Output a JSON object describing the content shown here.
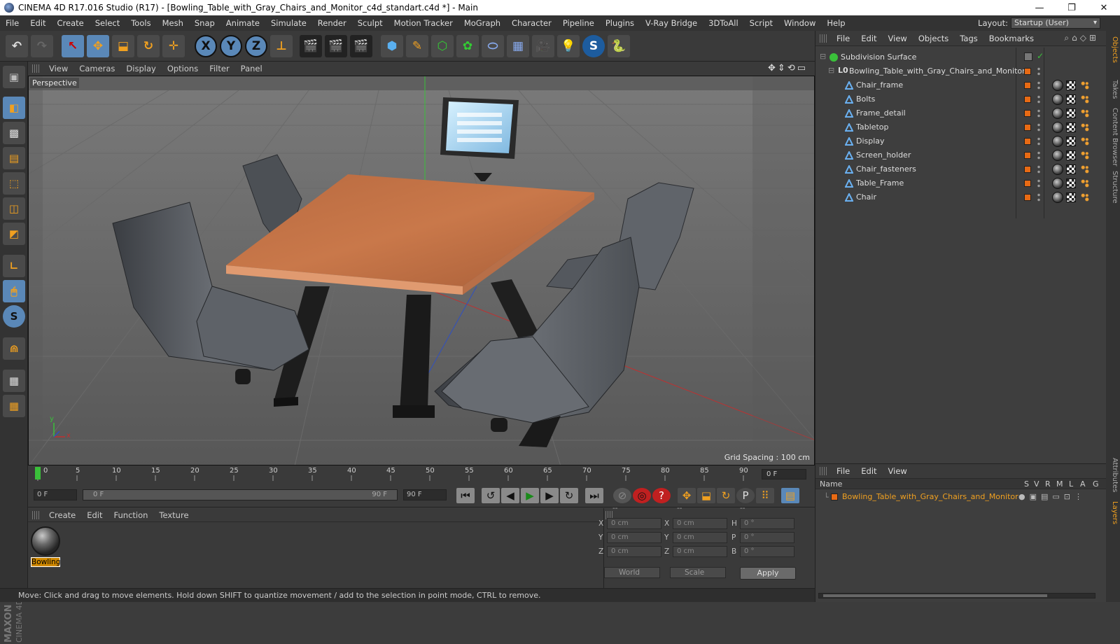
{
  "window": {
    "title": "CINEMA 4D R17.016 Studio (R17) - [Bowling_Table_with_Gray_Chairs_and_Monitor_c4d_standart.c4d *] - Main",
    "controls": [
      "—",
      "❐",
      "✕"
    ]
  },
  "menubar": {
    "items": [
      "File",
      "Edit",
      "Create",
      "Select",
      "Tools",
      "Mesh",
      "Snap",
      "Animate",
      "Simulate",
      "Render",
      "Sculpt",
      "Motion Tracker",
      "MoGraph",
      "Character",
      "Pipeline",
      "Plugins",
      "V-Ray Bridge",
      "3DToAll",
      "Script",
      "Window",
      "Help"
    ],
    "layout_label": "Layout:",
    "layout_value": "Startup (User)"
  },
  "toolbar": {
    "axis_x": "X",
    "axis_y": "Y",
    "axis_z": "Z"
  },
  "viewport": {
    "menu": [
      "View",
      "Cameras",
      "Display",
      "Options",
      "Filter",
      "Panel"
    ],
    "label": "Perspective",
    "grid_spacing": "Grid Spacing : 100 cm",
    "axis_y": "y",
    "axis_x": "x"
  },
  "timeline": {
    "ticks": [
      "0",
      "5",
      "10",
      "15",
      "20",
      "25",
      "30",
      "35",
      "40",
      "45",
      "50",
      "55",
      "60",
      "65",
      "70",
      "75",
      "80",
      "85",
      "90"
    ],
    "current_frame": "0 F"
  },
  "transport": {
    "start_field": "0 F",
    "range_start": "0 F",
    "range_end": "90 F",
    "end_field": "90 F"
  },
  "material_manager": {
    "menu": [
      "Create",
      "Edit",
      "Function",
      "Texture"
    ],
    "material_name": "Bowling"
  },
  "coordinates": {
    "headers": [
      "--",
      "--",
      "--"
    ],
    "rows": [
      {
        "l1": "X",
        "v1": "0 cm",
        "l2": "X",
        "v2": "0 cm",
        "l3": "H",
        "v3": "0 °"
      },
      {
        "l1": "Y",
        "v1": "0 cm",
        "l2": "Y",
        "v2": "0 cm",
        "l3": "P",
        "v3": "0 °"
      },
      {
        "l1": "Z",
        "v1": "0 cm",
        "l2": "Z",
        "v2": "0 cm",
        "l3": "B",
        "v3": "0 °"
      }
    ],
    "mode": "World",
    "type": "Scale",
    "apply": "Apply"
  },
  "status": "Move: Click and drag to move elements. Hold down SHIFT to quantize movement / add to the selection in point mode, CTRL to remove.",
  "objects_panel": {
    "menu": [
      "File",
      "Edit",
      "View",
      "Objects",
      "Tags",
      "Bookmarks"
    ],
    "root": "Subdivision Surface",
    "group": "Bowling_Table_with_Gray_Chairs_and_Monitor",
    "children": [
      "Chair_frame",
      "Bolts",
      "Frame_detail",
      "Tabletop",
      "Display",
      "Screen_holder",
      "Chair_fasteners",
      "Table_Frame",
      "Chair"
    ]
  },
  "layers_panel": {
    "menu": [
      "File",
      "Edit",
      "View"
    ],
    "name_header": "Name",
    "col_headers": [
      "S",
      "V",
      "R",
      "M",
      "L",
      "A",
      "G"
    ],
    "layer_name": "Bowling_Table_with_Gray_Chairs_and_Monitor"
  },
  "side_tabs": [
    "Objects",
    "Takes",
    "Content Browser",
    "Structure",
    "Attributes",
    "Layers"
  ],
  "colors": {
    "accent_orange": "#e86a14",
    "layer_text": "#f0a020",
    "tabletop": "#c9784a"
  }
}
